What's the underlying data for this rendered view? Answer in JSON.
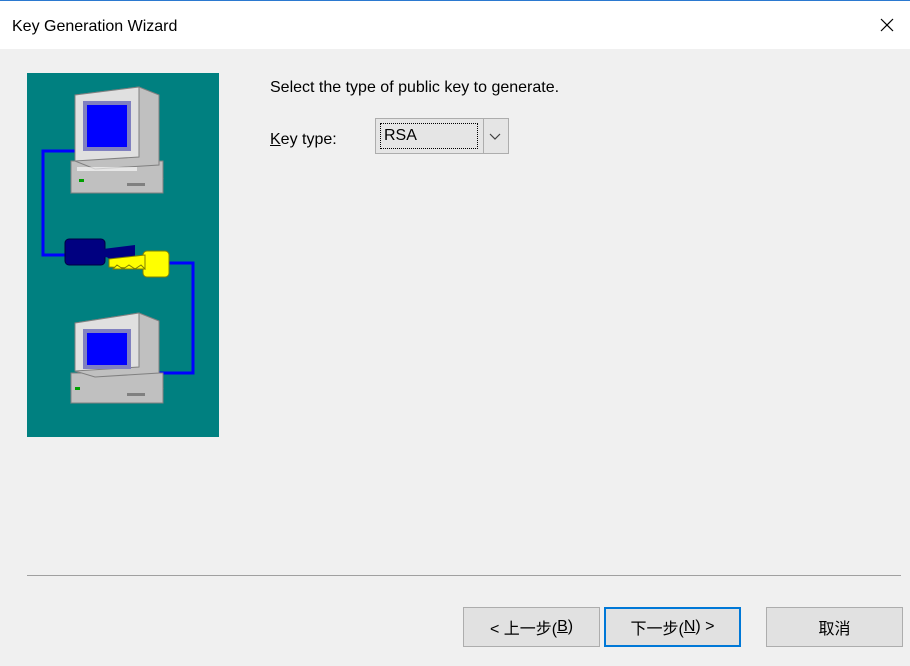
{
  "window": {
    "title": "Key Generation Wizard"
  },
  "content": {
    "prompt": "Select the type of public key to generate.",
    "key_type_label_mnemonic": "K",
    "key_type_label_rest": "ey type:",
    "key_type_value": "RSA"
  },
  "buttons": {
    "back_prefix": "< 上一步(",
    "back_mnemonic": "B",
    "back_suffix": ")",
    "next_prefix": "下一步(",
    "next_mnemonic": "N",
    "next_suffix": ") >",
    "cancel": "取消"
  },
  "colors": {
    "illustration_bg": "#008080",
    "accent_border": "#0078d7",
    "key_gold": "#ffff00",
    "key_navy": "#000080"
  },
  "icons": {
    "close": "close-icon",
    "dropdown": "chevron-down-icon",
    "illustration": "computers-key-illustration"
  }
}
